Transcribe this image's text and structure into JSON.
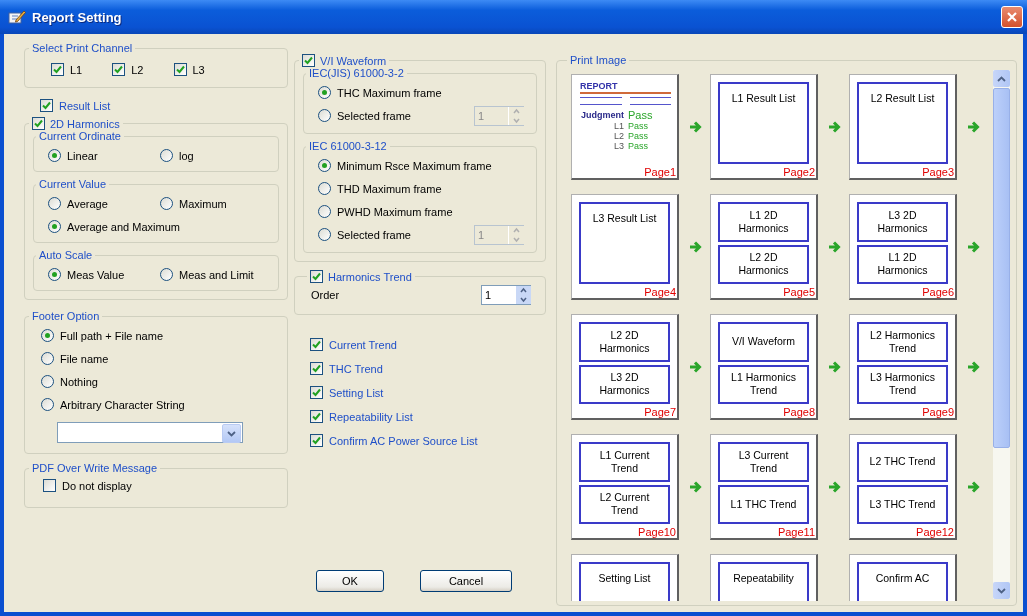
{
  "window": {
    "title": "Report Setting"
  },
  "print_channel": {
    "title": "Select Print Channel",
    "channels": [
      {
        "label": "L1",
        "checked": true
      },
      {
        "label": "L2",
        "checked": true
      },
      {
        "label": "L3",
        "checked": true
      }
    ]
  },
  "result_list": {
    "label": "Result List",
    "checked": true
  },
  "harmonics_2d": {
    "label": "2D Harmonics",
    "checked": true,
    "groups": [
      {
        "title": "Current Ordinate",
        "options": [
          {
            "label": "Linear",
            "selected": true
          },
          {
            "label": "log",
            "selected": false
          }
        ]
      },
      {
        "title": "Current Value",
        "options": [
          {
            "label": "Average",
            "selected": false
          },
          {
            "label": "Maximum",
            "selected": false
          },
          {
            "label": "Average and Maximum",
            "selected": true
          }
        ]
      },
      {
        "title": "Auto Scale",
        "options": [
          {
            "label": "Meas Value",
            "selected": true
          },
          {
            "label": "Meas and Limit",
            "selected": false
          }
        ]
      }
    ]
  },
  "footer_option": {
    "title": "Footer Option",
    "options": [
      {
        "label": "Full path + File name",
        "selected": true
      },
      {
        "label": "File name",
        "selected": false
      },
      {
        "label": "Nothing",
        "selected": false
      },
      {
        "label": "Arbitrary Character String",
        "selected": false
      }
    ]
  },
  "pdf_overwrite": {
    "title": "PDF Over Write Message",
    "checkbox": {
      "label": "Do not display",
      "checked": false
    }
  },
  "vi_waveform": {
    "label": "V/I Waveform",
    "checked": true,
    "groups": [
      {
        "title": "IEC(JIS) 61000-3-2",
        "options": [
          {
            "label": "THC Maximum frame",
            "selected": true
          },
          {
            "label": "Selected frame",
            "selected": false,
            "spin": {
              "value": "1",
              "disabled": true
            }
          }
        ]
      },
      {
        "title": "IEC 61000-3-12",
        "options": [
          {
            "label": "Minimum Rsce Maximum frame",
            "selected": true
          },
          {
            "label": "THD Maximum frame",
            "selected": false
          },
          {
            "label": "PWHD Maximum frame",
            "selected": false
          },
          {
            "label": "Selected frame",
            "selected": false,
            "spin": {
              "value": "1",
              "disabled": true
            }
          }
        ]
      }
    ]
  },
  "harmonics_trend": {
    "label": "Harmonics Trend",
    "checked": true,
    "order": {
      "label": "Order",
      "value": "1"
    }
  },
  "trends": [
    {
      "label": "Current Trend",
      "checked": true
    },
    {
      "label": "THC Trend",
      "checked": true
    },
    {
      "label": "Setting List",
      "checked": true
    },
    {
      "label": "Repeatability List",
      "checked": true
    },
    {
      "label": "Confirm AC Power Source List",
      "checked": true
    }
  ],
  "buttons": [
    "OK",
    "Cancel"
  ],
  "print_image": {
    "title": "Print Image",
    "pages": [
      {
        "kind": "report",
        "page": "Page1",
        "heading": "REPORT",
        "judgment": "Judgment",
        "result": "Pass",
        "rows": [
          {
            "label": "L1",
            "result": "Pass"
          },
          {
            "label": "L2",
            "result": "Pass"
          },
          {
            "label": "L3",
            "result": "Pass"
          }
        ]
      },
      {
        "kind": "single",
        "page": "Page2",
        "blocks": [
          "L1 Result List"
        ]
      },
      {
        "kind": "single",
        "page": "Page3",
        "blocks": [
          "L2 Result List"
        ]
      },
      {
        "kind": "single",
        "page": "Page4",
        "blocks": [
          "L3 Result List"
        ]
      },
      {
        "kind": "double",
        "page": "Page5",
        "blocks": [
          "L1 2D Harmonics",
          "L2 2D Harmonics"
        ]
      },
      {
        "kind": "double",
        "page": "Page6",
        "blocks": [
          "L3 2D Harmonics",
          "L1 2D Harmonics"
        ]
      },
      {
        "kind": "double",
        "page": "Page7",
        "blocks": [
          "L2 2D Harmonics",
          "L3 2D Harmonics"
        ]
      },
      {
        "kind": "double",
        "page": "Page8",
        "blocks": [
          "V/I Waveform",
          "L1 Harmonics Trend"
        ]
      },
      {
        "kind": "double",
        "page": "Page9",
        "blocks": [
          "L2 Harmonics Trend",
          "L3 Harmonics Trend"
        ]
      },
      {
        "kind": "double",
        "page": "Page10",
        "blocks": [
          "L1 Current Trend",
          "L2 Current Trend"
        ]
      },
      {
        "kind": "double",
        "page": "Page11",
        "blocks": [
          "L3 Current Trend",
          "L1 THC Trend"
        ]
      },
      {
        "kind": "double",
        "page": "Page12",
        "blocks": [
          "L2 THC Trend",
          "L3 THC Trend"
        ]
      },
      {
        "kind": "single",
        "blocks": [
          "Setting List"
        ]
      },
      {
        "kind": "single",
        "blocks": [
          "Repeatability"
        ]
      },
      {
        "kind": "single",
        "blocks": [
          "Confirm AC"
        ]
      }
    ]
  }
}
